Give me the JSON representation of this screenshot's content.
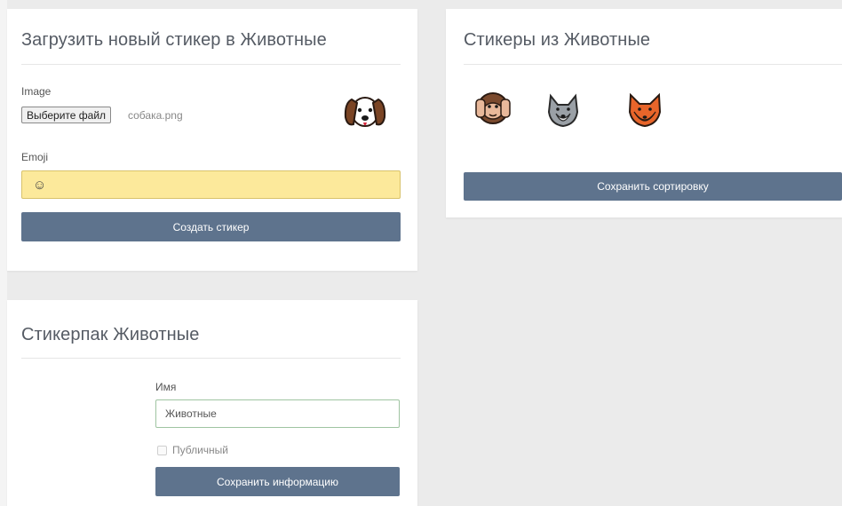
{
  "upload": {
    "title": "Загрузить новый стикер в Животные",
    "image_label": "Image",
    "file_button": "Выберите файл",
    "file_name": "собака.png",
    "preview_icon": "dog-face-icon",
    "emoji_label": "Emoji",
    "emoji_value": "☺",
    "create_button": "Создать стикер"
  },
  "stickers": {
    "title": "Стикеры из Животные",
    "items": [
      {
        "icon": "monkey-hear-no-evil-icon"
      },
      {
        "icon": "wolf-face-icon"
      },
      {
        "icon": "fox-face-icon"
      }
    ],
    "save_sort_button": "Сохранить сортировку"
  },
  "pack": {
    "title": "Стикерпак Животные",
    "name_label": "Имя",
    "name_value": "Животные",
    "public_label": "Публичный",
    "public_checked": false,
    "save_info_button": "Сохранить информацию"
  },
  "colors": {
    "button": "#5e738d",
    "emoji_field": "#fce99b",
    "name_field_border": "#9fc4a1"
  }
}
